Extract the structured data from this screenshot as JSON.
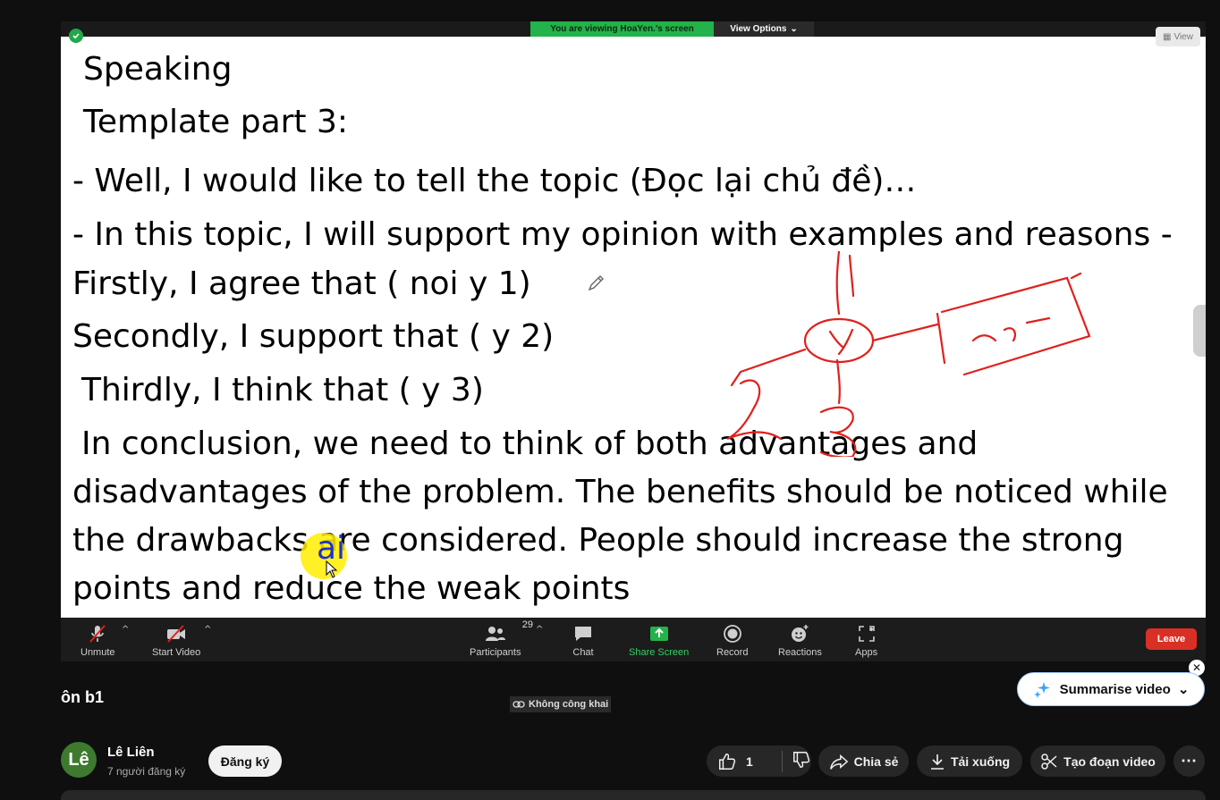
{
  "zoom": {
    "viewing_banner": "You are viewing HoaYen.'s screen",
    "view_options": "View Options",
    "view_button": "View",
    "slide_lines": [
      "Speaking",
      "Template part 3:",
      "- Well, I would like to tell the topic (Đọc lại chủ đề)…",
      "- In this topic, I will support my opinion with examples and reasons -",
      "Firstly, I agree that ( noi y 1)",
      "Secondly, I support that ( y 2)",
      "Thirdly, I think that ( y 3)",
      "In conclusion, we need to think of both advantages and",
      "disadvantages of the problem. The benefits should be noticed while",
      "the drawbacks are considered. People should increase the strong",
      "points and reduce the weak points"
    ],
    "cursor_letters": "ai",
    "toolbar": {
      "unmute": "Unmute",
      "start_video": "Start Video",
      "participants": "Participants",
      "participants_count": "29",
      "chat": "Chat",
      "share_screen": "Share Screen",
      "record": "Record",
      "reactions": "Reactions",
      "apps": "Apps",
      "leave": "Leave"
    },
    "colors": {
      "share_green": "#24b24a",
      "leave_red": "#d93025",
      "ink_red": "#e0201c"
    }
  },
  "youtube": {
    "title": "ôn b1",
    "privacy": "Không công khai",
    "summarise": "Summarise video",
    "channel": {
      "avatar_letter": "Lê",
      "name": "Lê Liên",
      "subscribers": "7 người đăng ký"
    },
    "subscribe": "Đăng ký",
    "likes": "1",
    "share": "Chia sẻ",
    "download": "Tải xuống",
    "clip": "Tạo đoạn video"
  }
}
